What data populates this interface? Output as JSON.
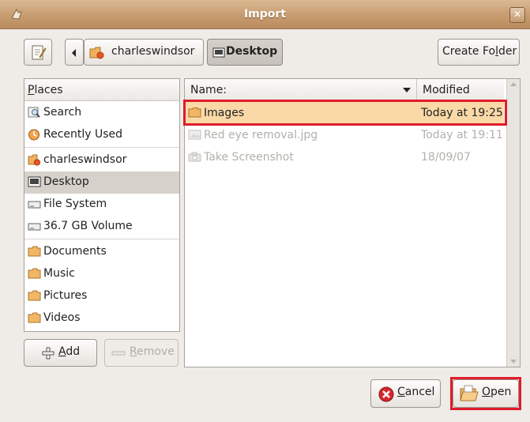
{
  "window": {
    "title": "Import"
  },
  "toolbar": {
    "path_buttons": [
      "charleswindsor",
      "Desktop"
    ],
    "create_folder_label_pre": "Create Fo",
    "create_folder_label_mn": "l",
    "create_folder_label_post": "der"
  },
  "places": {
    "header": "Places",
    "header_mn": "P",
    "header_rest": "laces",
    "items": [
      {
        "label": "Search",
        "icon": "search-icon"
      },
      {
        "label": "Recently Used",
        "icon": "recent-icon"
      },
      {
        "label": "charleswindsor",
        "icon": "home-folder-icon"
      },
      {
        "label": "Desktop",
        "icon": "desktop-icon",
        "selected": true
      },
      {
        "label": "File System",
        "icon": "drive-icon"
      },
      {
        "label": "36.7 GB Volume",
        "icon": "drive-icon"
      },
      {
        "label": "Documents",
        "icon": "folder-icon"
      },
      {
        "label": "Music",
        "icon": "folder-icon"
      },
      {
        "label": "Pictures",
        "icon": "folder-icon"
      },
      {
        "label": "Videos",
        "icon": "folder-icon"
      }
    ],
    "add_mn": "A",
    "add_rest": "dd",
    "remove_mn": "R",
    "remove_rest": "emove"
  },
  "files": {
    "col_name": "Name:",
    "col_modified": "Modified",
    "rows": [
      {
        "name": "Images",
        "modified": "Today at 19:25",
        "icon": "folder-icon",
        "state": "selected"
      },
      {
        "name": "Red eye removal.jpg",
        "modified": "Today at 19:11",
        "icon": "image-file-icon",
        "state": "disabled"
      },
      {
        "name": "Take Screenshot",
        "modified": "18/09/07",
        "icon": "camera-icon",
        "state": "disabled"
      }
    ]
  },
  "actions": {
    "cancel_mn": "C",
    "cancel_rest": "ancel",
    "open_mn": "O",
    "open_rest": "pen"
  },
  "colors": {
    "titlebar": "#c79c6f",
    "selection": "#fbd9a7",
    "highlight_box": "#e01c2b"
  }
}
